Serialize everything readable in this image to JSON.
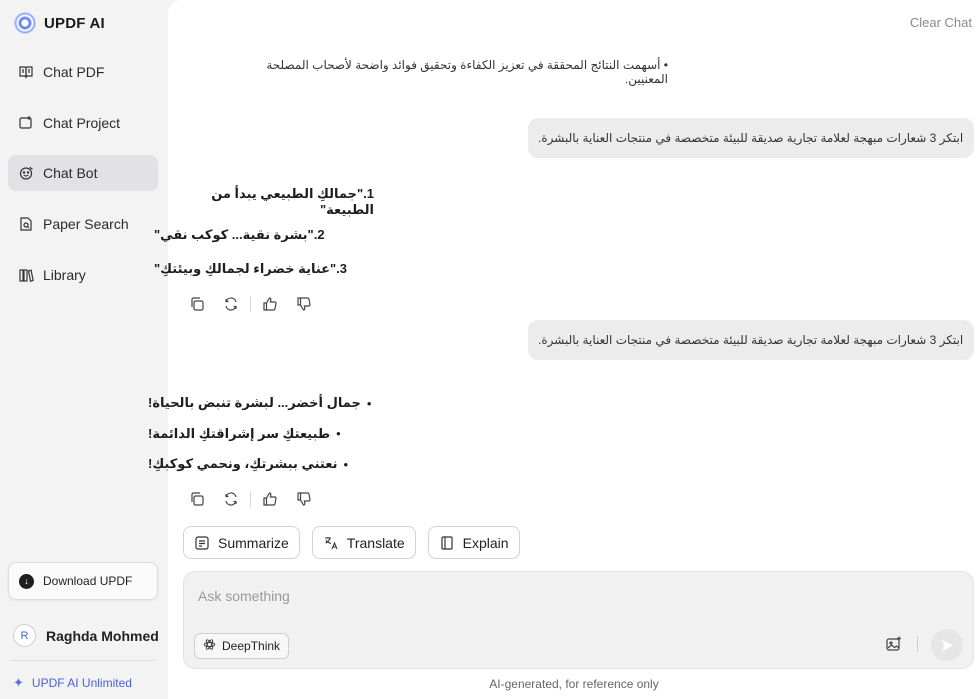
{
  "brand": {
    "name": "UPDF AI"
  },
  "nav": [
    {
      "label": "Chat PDF",
      "icon": "book-icon",
      "active": false
    },
    {
      "label": "Chat Project",
      "icon": "folder-plus-icon",
      "active": false
    },
    {
      "label": "Chat Bot",
      "icon": "bot-face-icon",
      "active": true
    },
    {
      "label": "Paper Search",
      "icon": "document-search-icon",
      "active": false
    },
    {
      "label": "Library",
      "icon": "library-books-icon",
      "active": false
    }
  ],
  "download": {
    "label": "Download UPDF"
  },
  "user": {
    "initial": "R",
    "name": "Raghda Mohmed"
  },
  "upgrade": {
    "label": "UPDF AI Unlimited"
  },
  "header": {
    "clear_chat": "Clear Chat"
  },
  "chat": {
    "ai_top_line": "• أسهمت النتائج المحققة في تعزيز الكفاءة وتحقيق فوائد واضحة لأصحاب المصلحة المعنيين.",
    "user_msg_1": "ابتكر 3 شعارات مبهجة لعلامة تجارية صديقة للبيئة متخصصة في منتجات العناية بالبشرة.",
    "ai_list_1": [
      "1.\"جمالكِ الطبيعي يبدأ من الطبيعة\"",
      "2.\"بشرة نقية... كوكب نقي\"",
      "3.\"عناية خضراء لجمالكِ وبيئتكِ\""
    ],
    "user_msg_2": "ابتكر 3 شعارات مبهجة لعلامة تجارية صديقة للبيئة متخصصة في منتجات العناية بالبشرة.",
    "ai_list_2": [
      "جمال أخضر... لبشرة تنبض بالحياة!",
      "طبيعتكِ سر إشراقتكِ الدائمة!",
      "نعتني ببشرتكِ، ونحمي كوكبكِ!"
    ],
    "bullet": "•"
  },
  "quick_actions": [
    {
      "label": "Summarize",
      "icon": "summarize-icon"
    },
    {
      "label": "Translate",
      "icon": "translate-icon"
    },
    {
      "label": "Explain",
      "icon": "book-open-icon"
    }
  ],
  "composer": {
    "placeholder": "Ask something",
    "deepthink_label": "DeepThink"
  },
  "footer": {
    "disclaimer": "AI-generated, for reference only"
  },
  "colors": {
    "accent": "#4b5fd6",
    "active_nav": "#e2e2e4",
    "bubble": "#ececec"
  }
}
